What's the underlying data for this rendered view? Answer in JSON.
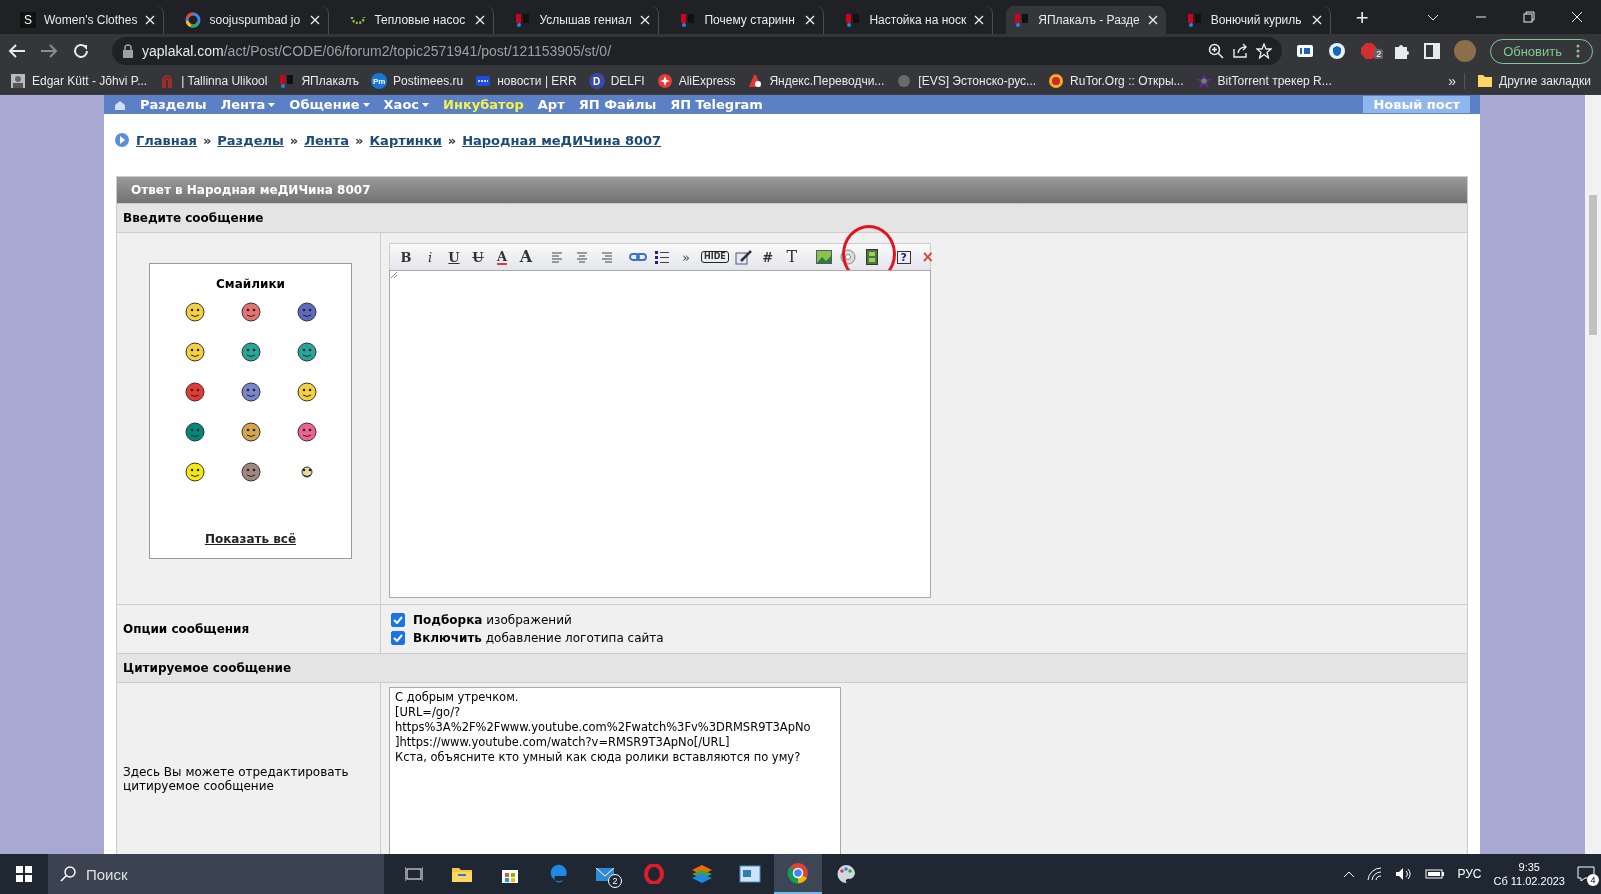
{
  "browser": {
    "tabs": [
      {
        "title": "Women's Clothes",
        "kind": "letter",
        "icon_text": "S",
        "selected": false
      },
      {
        "title": "soojuspumbad jo",
        "kind": "google",
        "selected": false
      },
      {
        "title": "Тепловые насос",
        "kind": "spinner",
        "selected": false
      },
      {
        "title": "Услышав гениал",
        "kind": "yap",
        "selected": false
      },
      {
        "title": "Почему старинн",
        "kind": "yap",
        "selected": false
      },
      {
        "title": "Настойка на носк",
        "kind": "yap",
        "selected": false
      },
      {
        "title": "ЯПлакалъ - Разде",
        "kind": "yap",
        "selected": true
      },
      {
        "title": "Вонючий куриль",
        "kind": "yap",
        "selected": false
      }
    ],
    "new_tab": "+",
    "url_host": "yaplakal.com",
    "url_path": "/act/Post/CODE/06/forum2/topic2571941/post/121153905/st/0/",
    "extension_badge": "2",
    "update_button": "Обновить",
    "bookmarks": [
      {
        "label": "Edgar Kütt - Jõhvi P...",
        "kind": "photo"
      },
      {
        "label": "| Tallinna Ulikool",
        "kind": "arch"
      },
      {
        "label": "ЯПлакалъ",
        "kind": "yap"
      },
      {
        "label": "Postimees.ru",
        "kind": "pm",
        "icon_text": "Pm"
      },
      {
        "label": "новости | ERR",
        "kind": "err"
      },
      {
        "label": "DELFI",
        "kind": "delfi",
        "icon_text": "D"
      },
      {
        "label": "AliExpress",
        "kind": "ali"
      },
      {
        "label": "Яндекс.Переводчи...",
        "kind": "yandex"
      },
      {
        "label": "[EVS] Эстонско-рус...",
        "kind": "blank"
      },
      {
        "label": "RuTor.Org :: Откры...",
        "kind": "rutor"
      },
      {
        "label": "BitTorrent трекер R...",
        "kind": "bittorrent"
      }
    ],
    "bookmarks_more": "»",
    "other_bookmarks": "Другие закладки"
  },
  "site": {
    "nav": [
      {
        "label": "Разделы",
        "dropdown": false,
        "highlighted": false
      },
      {
        "label": "Лента",
        "dropdown": true,
        "highlighted": false
      },
      {
        "label": "Общение",
        "dropdown": true,
        "highlighted": false
      },
      {
        "label": "Хаос",
        "dropdown": true,
        "highlighted": false
      },
      {
        "label": "Инкубатор",
        "dropdown": false,
        "highlighted": true
      },
      {
        "label": "Арт",
        "dropdown": false,
        "highlighted": false
      },
      {
        "label": "ЯП Файлы",
        "dropdown": false,
        "highlighted": false
      },
      {
        "label": "ЯП Telegram",
        "dropdown": false,
        "highlighted": false
      }
    ],
    "new_post_button": "Новый пост",
    "breadcrumbs": [
      "Главная",
      "Разделы",
      "Лента",
      "Картинки",
      "Народная меДИЧина 8007"
    ],
    "breadcrumb_separator": "»",
    "form": {
      "title": "Ответ в Народная меДИЧина 8007",
      "message_label": "Введите сообщение",
      "smileys_title": "Смайлики",
      "show_all": "Показать всё",
      "toolbar": [
        {
          "kind": "bold",
          "label": "B",
          "circled": false
        },
        {
          "kind": "italic",
          "label": "i",
          "circled": false
        },
        {
          "kind": "underline",
          "label": "U",
          "circled": false
        },
        {
          "kind": "strike",
          "label": "U",
          "circled": false
        },
        {
          "kind": "color",
          "label": "A",
          "circled": false
        },
        {
          "kind": "size",
          "label": "A",
          "circled": false
        },
        {
          "kind": "separator"
        },
        {
          "kind": "align-left",
          "circled": false
        },
        {
          "kind": "align-center",
          "circled": false
        },
        {
          "kind": "align-right",
          "circled": false
        },
        {
          "kind": "separator"
        },
        {
          "kind": "link",
          "circled": false
        },
        {
          "kind": "list",
          "circled": false
        },
        {
          "kind": "quote",
          "label": "»",
          "circled": false
        },
        {
          "kind": "hide",
          "label": "HIDE",
          "circled": false
        },
        {
          "kind": "edit",
          "circled": false
        },
        {
          "kind": "hash",
          "label": "#",
          "circled": false
        },
        {
          "kind": "text",
          "label": "T",
          "circled": false
        },
        {
          "kind": "separator"
        },
        {
          "kind": "image",
          "circled": false
        },
        {
          "kind": "disc",
          "circled": false
        },
        {
          "kind": "video",
          "circled": true
        },
        {
          "kind": "separator"
        },
        {
          "kind": "help",
          "label": "?",
          "circled": false
        },
        {
          "kind": "close",
          "label": "×",
          "circled": false
        }
      ],
      "options_label": "Опции сообщения",
      "options": [
        {
          "text": "**Подборка** изображений",
          "checked": true
        },
        {
          "text": "**Включить** добавление логотипа сайта",
          "checked": true
        }
      ],
      "quoted_label": "Цитируемое сообщение",
      "quoted_hint": "Здесь Вы можете отредактировать цитируемое сообщение",
      "quoted_text": "С добрым утречком.\n[URL=/go/?\nhttps%3A%2F%2Fwww.youtube.com%2Fwatch%3Fv%3DRMSR9T3ApNo\n]https://www.youtube.com/watch?v=RMSR9T3ApNo[/URL]\nКста, объясните кто умный как сюда ролики вставляются по уму?"
    }
  },
  "taskbar": {
    "search_placeholder": "Поиск",
    "apps": [
      {
        "kind": "taskview",
        "selected": false
      },
      {
        "kind": "explorer",
        "selected": false
      },
      {
        "kind": "store",
        "selected": false
      },
      {
        "kind": "edge",
        "selected": false
      },
      {
        "kind": "mail",
        "badge": "2",
        "selected": false
      },
      {
        "kind": "opera",
        "selected": false
      },
      {
        "kind": "layers",
        "selected": false
      },
      {
        "kind": "screen",
        "selected": false
      },
      {
        "kind": "chrome",
        "selected": true
      },
      {
        "kind": "paint",
        "selected": false
      }
    ],
    "language": "РУС",
    "time": "9:35",
    "date": "Сб 11.02.2023",
    "notifications": "4"
  }
}
